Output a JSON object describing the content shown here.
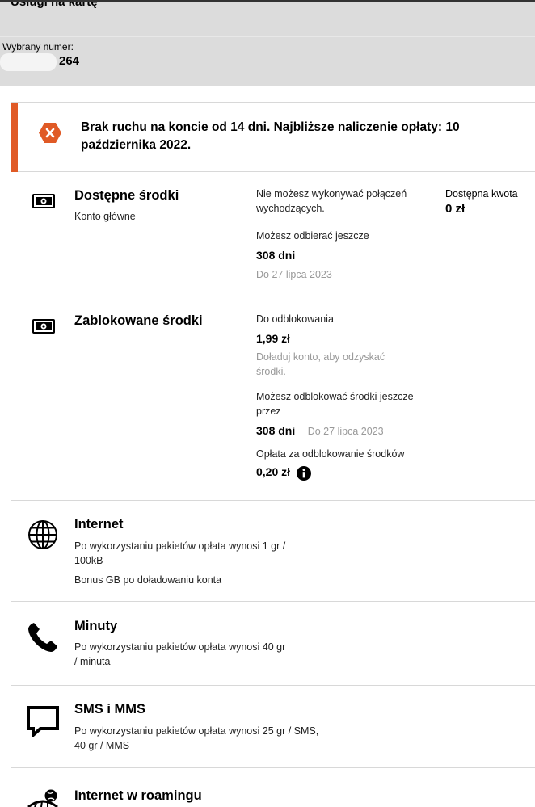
{
  "header": {
    "title": "Usługi na kartę",
    "number_label": "Wybrany numer:",
    "number_suffix": "264"
  },
  "alert": {
    "icon": "error-x-icon",
    "color": "#e05a26",
    "message": "Brak ruchu na koncie od 14 dni. Najbliższe naliczenie opłaty: 10 października 2022."
  },
  "available": {
    "icon": "banknote-icon",
    "title": "Dostępne środki",
    "subtitle": "Konto główne",
    "calls_note": "Nie możesz wykonywać połączeń wychodzących.",
    "receive_label": "Możesz odbierać jeszcze",
    "receive_days": "308 dni",
    "receive_until": "Do 27 lipca 2023",
    "amount_label": "Dostępna kwota",
    "amount_value": "0 zł"
  },
  "blocked": {
    "icon": "banknote-icon",
    "title": "Zablokowane środki",
    "unlock_label": "Do odblokowania",
    "unlock_amount": "1,99 zł",
    "unlock_hint": "Doładuj konto, aby odzyskać środki.",
    "unlock_time_label": "Możesz odblokować środki jeszcze przez",
    "unlock_days": "308 dni",
    "unlock_until": "Do 27 lipca 2023",
    "fee_label": "Opłata za odblokowanie środków",
    "fee_value": "0,20 zł",
    "fee_info_icon": "info-icon"
  },
  "internet": {
    "icon": "globe-icon",
    "title": "Internet",
    "line1": "Po wykorzystaniu pakietów opłata wynosi 1 gr / 100kB",
    "line2": "Bonus GB po doładowaniu konta"
  },
  "minutes": {
    "icon": "phone-icon",
    "title": "Minuty",
    "line1": "Po wykorzystaniu pakietów opłata wynosi 40 gr / minuta"
  },
  "sms": {
    "icon": "chat-bubble-icon",
    "title": "SMS i MMS",
    "line1": "Po wykorzystaniu pakietów opłata wynosi 25 gr / SMS, 40 gr / MMS"
  },
  "roaming": {
    "icon": "roaming-globe-icon",
    "title": "Internet w roamingu"
  }
}
